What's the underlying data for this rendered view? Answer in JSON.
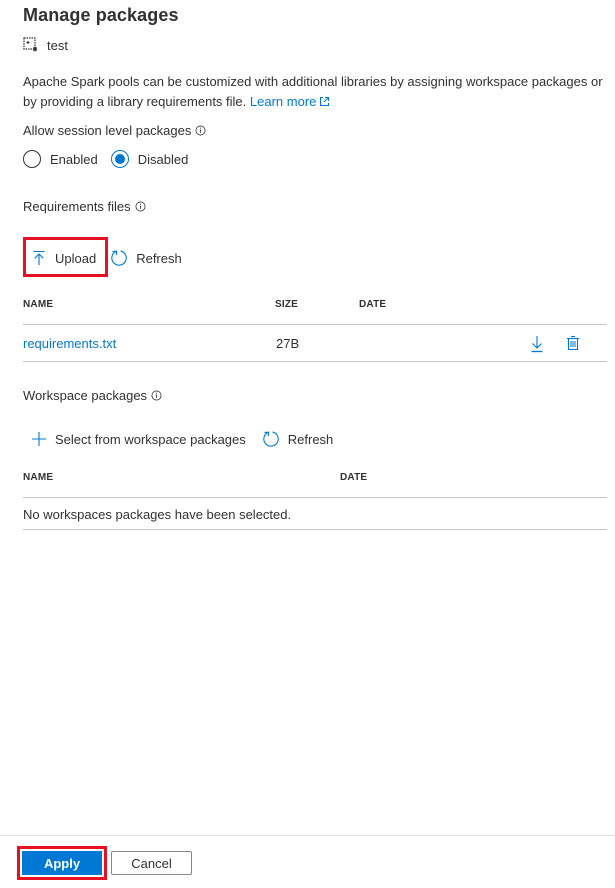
{
  "header": {
    "title": "Manage packages",
    "pool_icon": "spark-pool-icon",
    "pool_name": "test"
  },
  "description": {
    "text": "Apache Spark pools can be customized with additional libraries by assigning workspace packages or by providing a library requirements file.",
    "link_label": "Learn more",
    "link_icon": "external-link-icon"
  },
  "session_packages": {
    "label": "Allow session level packages",
    "info_icon": "info-icon",
    "options": [
      {
        "label": "Enabled",
        "checked": false
      },
      {
        "label": "Disabled",
        "checked": true
      }
    ]
  },
  "requirements": {
    "label": "Requirements files",
    "info_icon": "info-icon",
    "toolbar": {
      "upload_label": "Upload",
      "upload_icon": "upload-icon",
      "refresh_label": "Refresh",
      "refresh_icon": "refresh-icon"
    },
    "columns": [
      "NAME",
      "SIZE",
      "DATE"
    ],
    "rows": [
      {
        "name": "requirements.txt",
        "size": "27B",
        "date": "",
        "actions": [
          "download-icon",
          "delete-icon"
        ]
      }
    ]
  },
  "workspace_packages": {
    "label": "Workspace packages",
    "info_icon": "info-icon",
    "toolbar": {
      "select_label": "Select from workspace packages",
      "select_icon": "add-icon",
      "refresh_label": "Refresh",
      "refresh_icon": "refresh-icon"
    },
    "columns": [
      "NAME",
      "DATE"
    ],
    "empty_message": "No workspaces packages have been selected."
  },
  "footer": {
    "apply_label": "Apply",
    "cancel_label": "Cancel"
  },
  "colors": {
    "accent": "#0078d4",
    "highlight": "#e81123",
    "text": "#323130",
    "divider": "#c8c6c4"
  }
}
